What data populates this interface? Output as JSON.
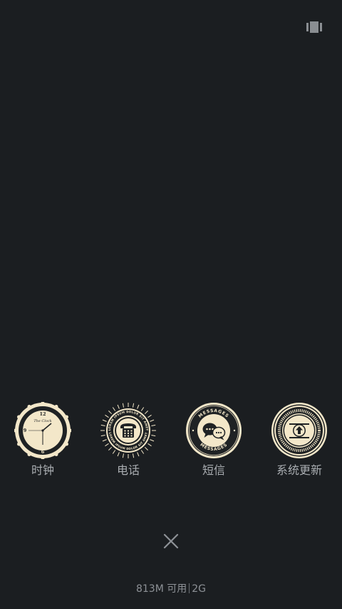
{
  "header": {
    "menu_icon": "multi-window-icon"
  },
  "apps": [
    {
      "label": "时钟",
      "icon": "clock-badge-icon",
      "badge_title": "The Clock",
      "numerals": [
        "12",
        "3",
        "6",
        "9"
      ]
    },
    {
      "label": "电话",
      "icon": "phone-badge-icon",
      "badge_text": "LOREM IPSUM DOLOR SIT AMET"
    },
    {
      "label": "短信",
      "icon": "messages-badge-icon",
      "badge_text": "MESSAGES"
    },
    {
      "label": "系统更新",
      "icon": "system-update-badge-icon"
    }
  ],
  "controls": {
    "close_icon": "close-icon"
  },
  "memory": {
    "available": "813M 可用",
    "total": "2G"
  },
  "colors": {
    "background": "#1b1e21",
    "badge_cream": "#f3e7c9",
    "badge_dark": "#1f2224",
    "label_text": "#a9adb1"
  }
}
